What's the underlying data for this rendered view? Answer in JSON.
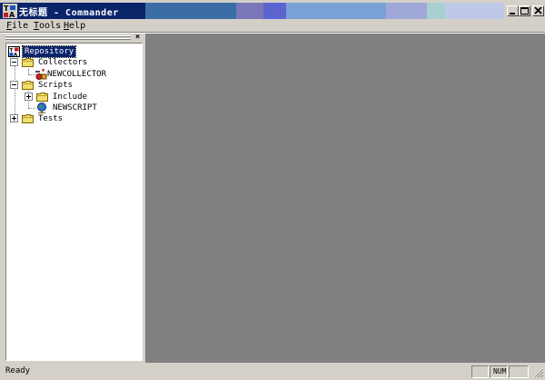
{
  "window": {
    "title": "无标题 - Commander",
    "title_colors": [
      "#0a246a",
      "#3a6ea5",
      "#5c7ec8",
      "#6a6aa8",
      "#8fa6d8",
      "#aeb8e0",
      "#a8c8d8",
      "#c8d0e8"
    ]
  },
  "menu": {
    "items": [
      {
        "accel": "F",
        "rest": "ile"
      },
      {
        "accel": "T",
        "rest": "ools"
      },
      {
        "accel": "H",
        "rest": "elp"
      }
    ]
  },
  "pane": {
    "close_glyph": "×"
  },
  "tree": {
    "repository": "Repository",
    "collectors": "Collectors",
    "newcollector": "NEWCOLLECTOR",
    "scripts": "Scripts",
    "include": "Include",
    "newscript": "NEWSCRIPT",
    "tests": "Tests"
  },
  "icons": {
    "app": "app-icon",
    "repository": "repository-icon",
    "folder": "folder-icon",
    "collector": "collector-icon",
    "script": "globe-script-icon"
  },
  "status": {
    "text": "Ready",
    "num": "NUM"
  },
  "colors": {
    "face": "#d4d0c8",
    "workspace": "#808080",
    "selection": "#0a246a",
    "folder": "#f0e070"
  }
}
